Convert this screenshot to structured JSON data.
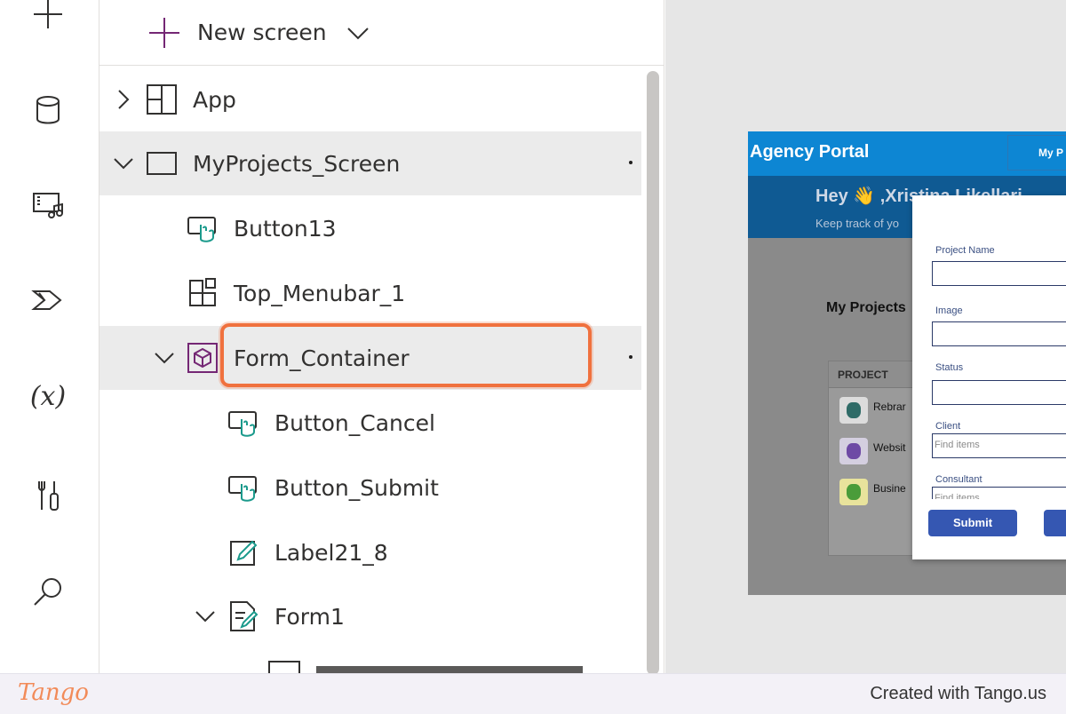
{
  "rail": {
    "items": [
      "add-icon",
      "data-icon",
      "media-icon",
      "power-automate-icon",
      "variables-icon",
      "advanced-tools-icon",
      "search-icon"
    ],
    "variables_glyph": "(x)"
  },
  "tree": {
    "new_screen_label": "New screen",
    "nodes": [
      {
        "label": "App",
        "icon": "app-icon"
      },
      {
        "label": "MyProjects_Screen",
        "icon": "screen-icon"
      },
      {
        "label": "Button13",
        "icon": "button-icon"
      },
      {
        "label": "Top_Menubar_1",
        "icon": "component-icon"
      },
      {
        "label": "Form_Container",
        "icon": "container-icon"
      },
      {
        "label": "Button_Cancel",
        "icon": "button-icon"
      },
      {
        "label": "Button_Submit",
        "icon": "button-icon"
      },
      {
        "label": "Label21_8",
        "icon": "label-icon"
      },
      {
        "label": "Form1",
        "icon": "form-icon"
      }
    ],
    "highlighted_node": "Form_Container",
    "highlight_color": "#f0713e",
    "selected_bg": "#ebebeb"
  },
  "preview": {
    "app_title": "Agency Portal",
    "nav_button": "My P",
    "greeting": "Hey 👋 ,Xristina Likellari",
    "greeting_sub": "Keep track of yo",
    "section_title": "My Projects",
    "table_header": "PROJECT",
    "rows": [
      {
        "text": "Rebrar",
        "color": "#2f6b67"
      },
      {
        "text": "Websit",
        "color": "#6e4aa5"
      },
      {
        "text": "Busine",
        "color": "#b7c43c"
      }
    ],
    "form": {
      "fields": [
        {
          "label": "Project Name",
          "value": ""
        },
        {
          "label": "Image",
          "value": ""
        },
        {
          "label": "Status",
          "value": ""
        },
        {
          "label": "Client",
          "value": "Find items"
        },
        {
          "label": "Consultant",
          "value": "Find items"
        }
      ],
      "submit_label": "Submit"
    },
    "header_color": "#0d86d3"
  },
  "footer": {
    "logo": "Tango",
    "created_with": "Created with Tango.us"
  }
}
